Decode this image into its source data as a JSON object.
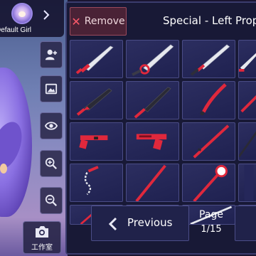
{
  "profile": {
    "name": "Default Girl",
    "arrow_icon": "chevron-right-icon"
  },
  "toolbar": {
    "items": [
      {
        "icon": "add-user-icon"
      },
      {
        "icon": "image-icon"
      },
      {
        "icon": "eye-icon"
      },
      {
        "icon": "zoom-in-icon"
      },
      {
        "icon": "zoom-out-icon"
      }
    ],
    "camera": {
      "icon": "camera-icon",
      "label": "工作室"
    }
  },
  "panel": {
    "remove_label": "Remove",
    "remove_icon": "close-icon",
    "title": "Special - Left Prop",
    "items": [
      {
        "name": "sword-1",
        "kind": "sword-red-hilt"
      },
      {
        "name": "sword-2",
        "kind": "sword-ring-guard"
      },
      {
        "name": "sword-3",
        "kind": "sword-red-guard"
      },
      {
        "name": "sword-4",
        "kind": "sword-partial"
      },
      {
        "name": "blade-5",
        "kind": "knife-red"
      },
      {
        "name": "blade-6",
        "kind": "sword-red-slim"
      },
      {
        "name": "blade-7",
        "kind": "red-dagger-curved"
      },
      {
        "name": "blade-8",
        "kind": "sword-partial-red"
      },
      {
        "name": "gun-9",
        "kind": "red-pistol-long"
      },
      {
        "name": "gun-10",
        "kind": "red-pistol"
      },
      {
        "name": "spear-11",
        "kind": "red-spear-hook"
      },
      {
        "name": "blade-12",
        "kind": "partial-dark"
      },
      {
        "name": "whip-13",
        "kind": "red-whip-chain"
      },
      {
        "name": "staff-14",
        "kind": "red-staff"
      },
      {
        "name": "staff-15",
        "kind": "red-orb-staff"
      },
      {
        "name": "prop-16",
        "kind": "partial-dark"
      },
      {
        "name": "scythe-17",
        "kind": "red-scythe"
      },
      {
        "name": "blade-18",
        "kind": "great-blade"
      },
      {
        "name": "spear-19",
        "kind": "white-spear"
      },
      {
        "name": "prop-20",
        "kind": "partial-dark"
      }
    ],
    "previous_label": "Previous",
    "previous_icon": "chevron-left-icon",
    "page_label": "Page",
    "page_value": "1/15",
    "colors": {
      "accent_red": "#e0283c",
      "blade_white": "#e6e8ee",
      "panel_bg": "#181936"
    }
  }
}
